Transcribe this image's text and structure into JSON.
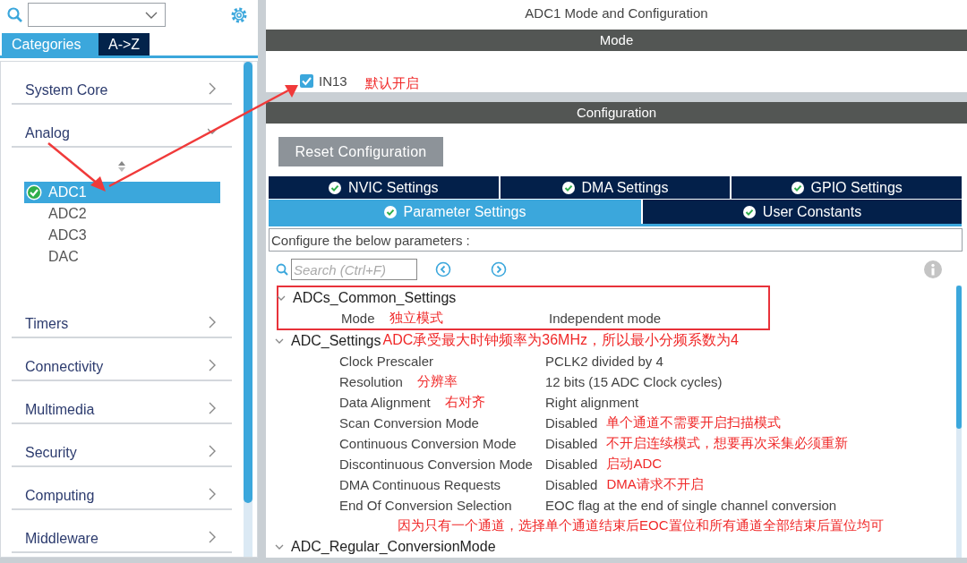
{
  "sidebar": {
    "tabs": [
      {
        "label": "Categories",
        "selected": true
      },
      {
        "label": "A->Z",
        "selected": false
      }
    ],
    "categories": [
      {
        "label": "System Core",
        "expanded": false
      },
      {
        "label": "Analog",
        "expanded": true,
        "children": [
          {
            "label": "ADC1",
            "selected": true,
            "checked": true
          },
          {
            "label": "ADC2",
            "selected": false,
            "checked": false
          },
          {
            "label": "ADC3",
            "selected": false,
            "checked": false
          },
          {
            "label": "DAC",
            "selected": false,
            "checked": false
          }
        ]
      },
      {
        "label": "Timers",
        "expanded": false
      },
      {
        "label": "Connectivity",
        "expanded": false
      },
      {
        "label": "Multimedia",
        "expanded": false
      },
      {
        "label": "Security",
        "expanded": false
      },
      {
        "label": "Computing",
        "expanded": false
      },
      {
        "label": "Middleware",
        "expanded": false
      }
    ]
  },
  "header": {
    "title": "ADC1 Mode and Configuration"
  },
  "mode": {
    "title": "Mode",
    "channels": [
      {
        "label": "IN13",
        "checked": true,
        "note": "默认开启"
      }
    ]
  },
  "configuration": {
    "title": "Configuration",
    "reset_button": "Reset Configuration",
    "tabs": [
      {
        "label": "NVIC Settings",
        "selected": false
      },
      {
        "label": "DMA Settings",
        "selected": false
      },
      {
        "label": "GPIO Settings",
        "selected": false
      },
      {
        "label": "Parameter Settings",
        "selected": true
      },
      {
        "label": "User Constants",
        "selected": false
      }
    ],
    "hint": "Configure the below parameters :",
    "search": {
      "placeholder": "Search (Ctrl+F)"
    },
    "parameters": [
      {
        "label": "ADCs_Common_Settings",
        "expanded": true,
        "highlighted": true,
        "children": [
          {
            "label": "Mode",
            "value": "Independent mode",
            "label_note": "独立模式"
          }
        ]
      },
      {
        "label": "ADC_Settings",
        "expanded": true,
        "note": "ADC承受最大时钟频率为36MHz，所以最小分频系数为4",
        "children": [
          {
            "label": "Clock Prescaler",
            "value": "PCLK2 divided by 4"
          },
          {
            "label": "Resolution",
            "value": "12 bits (15 ADC Clock cycles)",
            "label_note": "分辨率"
          },
          {
            "label": "Data Alignment",
            "value": "Right alignment",
            "label_note": "右对齐"
          },
          {
            "label": "Scan Conversion Mode",
            "value": "Disabled",
            "value_note": "单个通道不需要开启扫描模式"
          },
          {
            "label": "Continuous Conversion Mode",
            "value": "Disabled",
            "value_note": "不开启连续模式，想要再次采集必须重新"
          },
          {
            "label": "Discontinuous Conversion Mode",
            "value": "Disabled",
            "value_note": "启动ADC"
          },
          {
            "label": "DMA Continuous Requests",
            "value": "Disabled",
            "value_note": "DMA请求不开启"
          },
          {
            "label": "End Of Conversion Selection",
            "value": "EOC flag at the end of single channel conversion",
            "note_below": "因为只有一个通道，选择单个通道结束后EOC置位和所有通道全部结束后置位均可"
          }
        ]
      },
      {
        "label": "ADC_Regular_ConversionMode",
        "expanded": true
      }
    ]
  }
}
